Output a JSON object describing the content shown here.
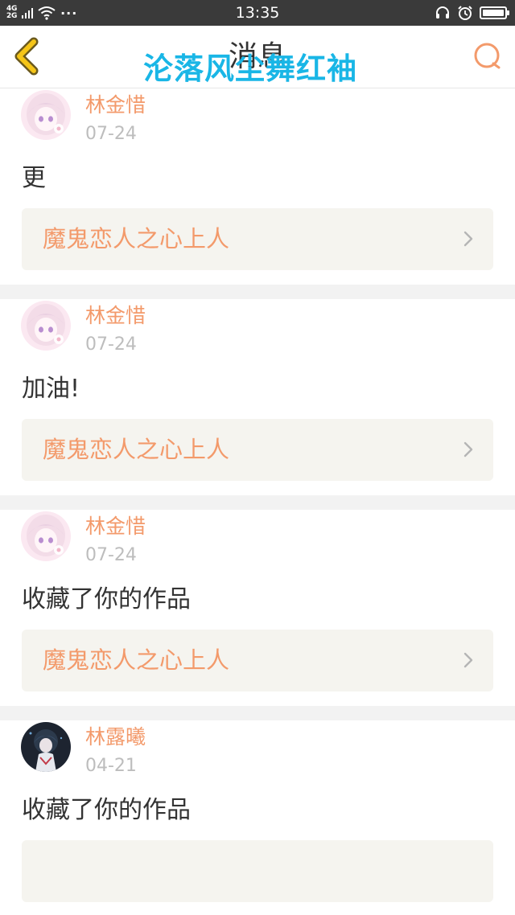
{
  "status_bar": {
    "network_top": "4G",
    "network_bottom": "2G",
    "more": "···",
    "time": "13:35",
    "icons": [
      "signal-icon",
      "wifi-icon",
      "headset-icon",
      "alarm-icon",
      "battery-icon"
    ]
  },
  "header": {
    "title": "消息",
    "back_icon": "chevron-left-icon",
    "search_icon": "search-icon",
    "accent_color": "#f5c518",
    "search_color": "#f39a6b"
  },
  "watermark": "沦落风尘舞红袖",
  "messages": [
    {
      "user": "林金惜",
      "date": "07-24",
      "text": "更",
      "work": "魔鬼恋人之心上人",
      "avatar": "pink-anime-avatar"
    },
    {
      "user": "林金惜",
      "date": "07-24",
      "text": "加油!",
      "work": "魔鬼恋人之心上人",
      "avatar": "pink-anime-avatar"
    },
    {
      "user": "林金惜",
      "date": "07-24",
      "text": "收藏了你的作品",
      "work": "魔鬼恋人之心上人",
      "avatar": "pink-anime-avatar"
    },
    {
      "user": "林露曦",
      "date": "04-21",
      "text": "收藏了你的作品",
      "work": "",
      "avatar": "dark-anime-avatar"
    }
  ],
  "colors": {
    "name": "#f39a6b",
    "date": "#bdbdbd",
    "card_bg": "#f5f4ef",
    "divider": "#f2f2f2",
    "watermark": "#19b6e6"
  }
}
